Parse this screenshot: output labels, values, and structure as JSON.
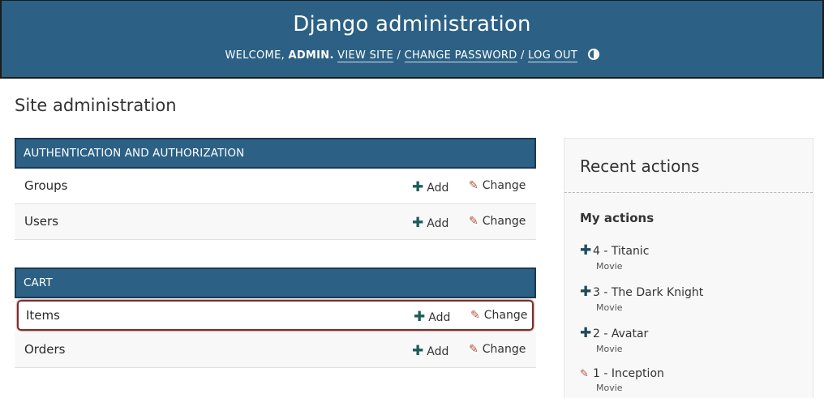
{
  "header": {
    "title": "Django administration",
    "welcome": "WELCOME,",
    "username": "ADMIN.",
    "view_site": "VIEW SITE",
    "change_password": "CHANGE PASSWORD",
    "log_out": "LOG OUT",
    "separator": "/",
    "theme_icon": "half-circle-icon"
  },
  "page_title": "Site administration",
  "apps": [
    {
      "caption": "AUTHENTICATION AND AUTHORIZATION",
      "models": [
        {
          "name": "Groups",
          "add": "Add",
          "change": "Change"
        },
        {
          "name": "Users",
          "add": "Add",
          "change": "Change"
        }
      ]
    },
    {
      "caption": "CART",
      "models": [
        {
          "name": "Items",
          "add": "Add",
          "change": "Change",
          "highlighted": true
        },
        {
          "name": "Orders",
          "add": "Add",
          "change": "Change"
        }
      ]
    }
  ],
  "recent": {
    "title": "Recent actions",
    "subtitle": "My actions",
    "actions": [
      {
        "icon": "addition-icon",
        "text": "4 - Titanic",
        "type": "Movie"
      },
      {
        "icon": "addition-icon",
        "text": "3 - The Dark Knight",
        "type": "Movie"
      },
      {
        "icon": "addition-icon",
        "text": "2 - Avatar",
        "type": "Movie"
      },
      {
        "icon": "change-icon",
        "text": "1 - Inception",
        "type": "Movie"
      }
    ]
  },
  "colors": {
    "header": "#2c6185",
    "caption": "#2c6185",
    "add_icon": "#1e5d5a",
    "change_icon": "#b5553a",
    "highlight_border": "#7a2e2e"
  }
}
